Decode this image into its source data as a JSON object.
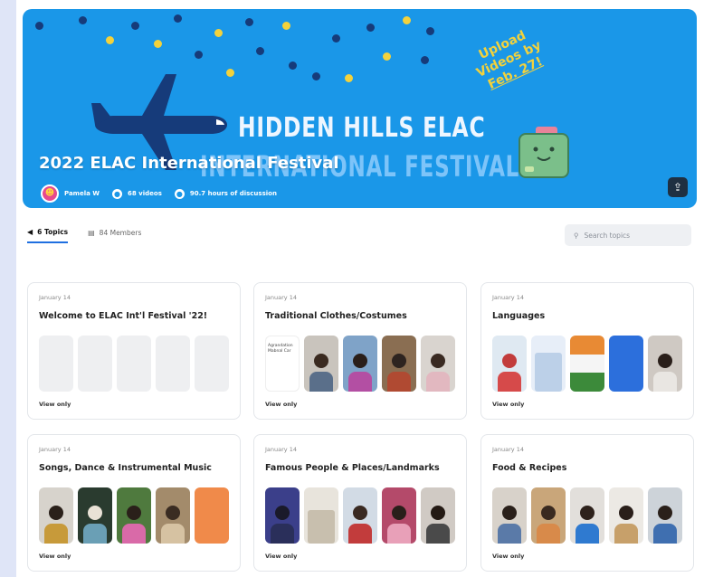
{
  "banner": {
    "title": "2022 ELAC International Festival",
    "art_title_line1": "HIDDEN HILLS ELAC",
    "art_title_line2": "INTERNATIONAL FESTIVAL",
    "upload_line1": "Upload",
    "upload_line2": "Videos by",
    "upload_line3": "Feb. 27!",
    "author": "Pamela W",
    "videos": "68 videos",
    "discussion": "90.7 hours of discussion",
    "share_icon": "share-icon",
    "colors": {
      "background": "#1a97e8",
      "dot_dark": "#163b7a",
      "dot_yellow": "#f3d23c"
    }
  },
  "tabs": [
    {
      "label": "6 Topics",
      "icon": "topics-icon",
      "active": true
    },
    {
      "label": "84 Members",
      "icon": "members-icon",
      "active": false
    }
  ],
  "search": {
    "placeholder": "Search topics",
    "icon": "search-icon"
  },
  "cards": [
    {
      "date": "January 14",
      "title": "Welcome to ELAC Int'l Festival '22!",
      "access": "View only"
    },
    {
      "date": "January 14",
      "title": "Traditional Clothes/Costumes",
      "access": "View only",
      "thumb_text": "Agrandation Mabnal Car"
    },
    {
      "date": "January 14",
      "title": "Languages",
      "access": "View only"
    },
    {
      "date": "January 14",
      "title": "Songs, Dance & Instrumental Music",
      "access": "View only"
    },
    {
      "date": "January 14",
      "title": "Famous People & Places/Landmarks",
      "access": "View only"
    },
    {
      "date": "January 14",
      "title": "Food & Recipes",
      "access": "View only"
    }
  ]
}
